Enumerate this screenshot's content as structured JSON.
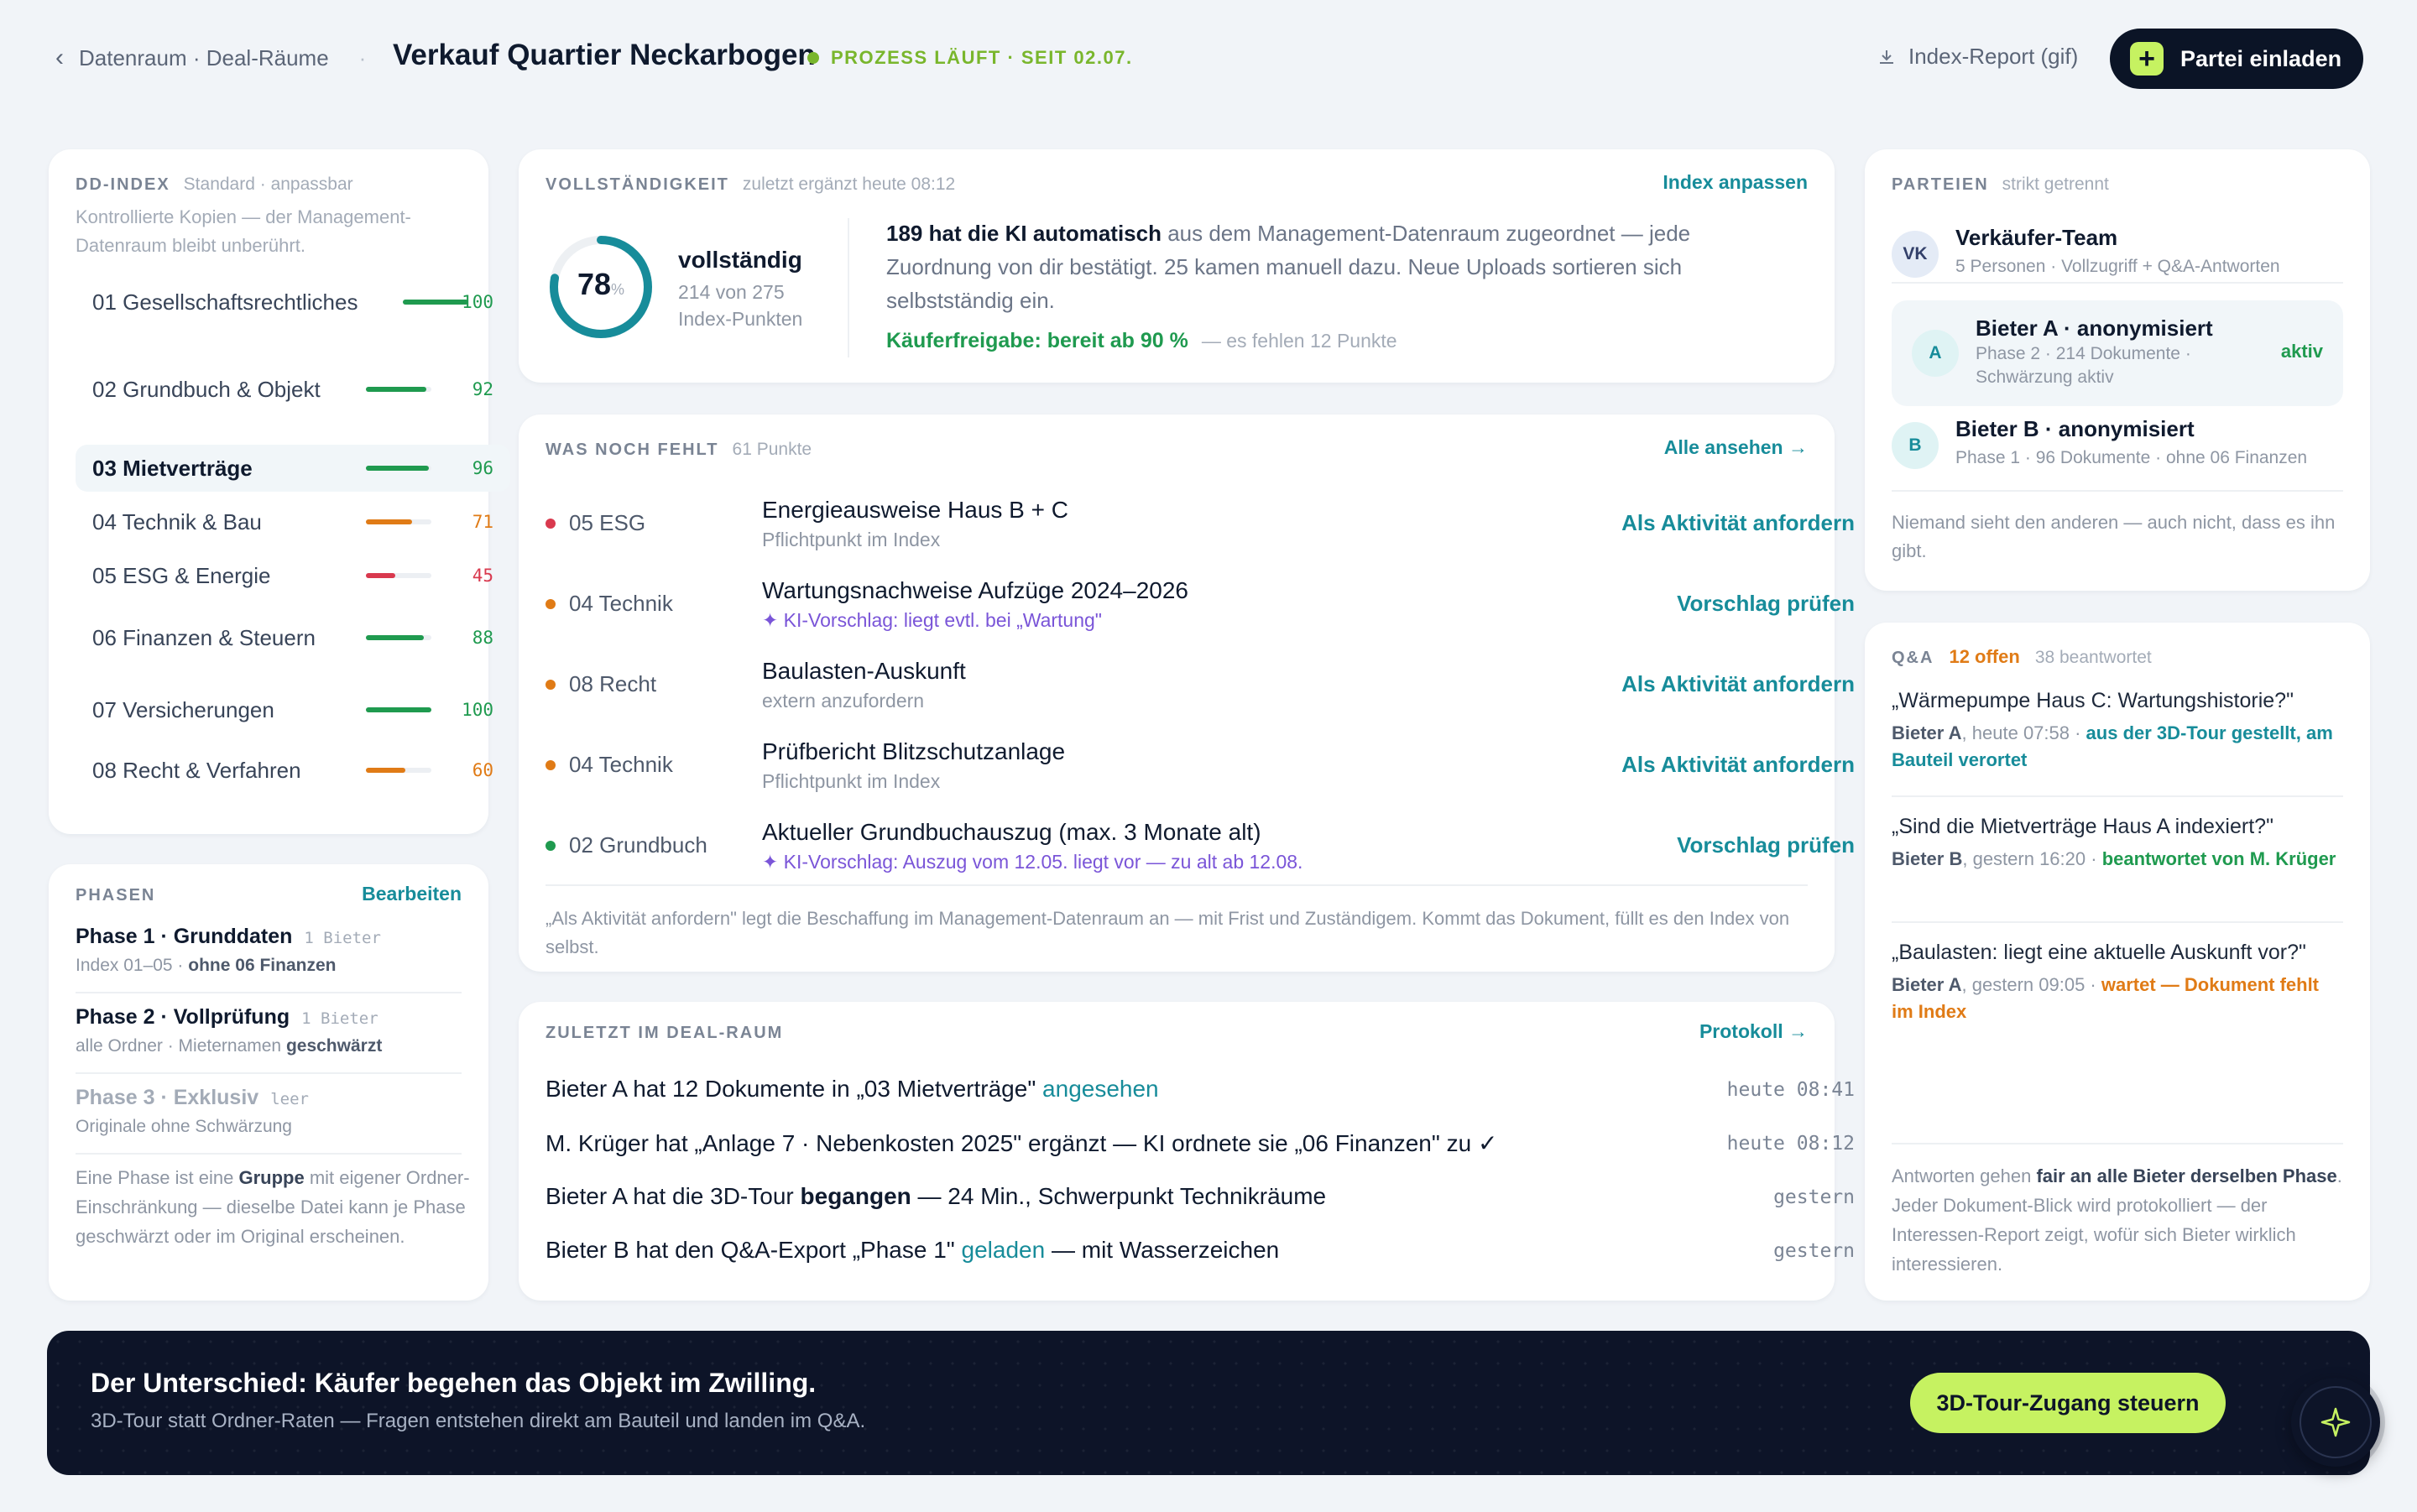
{
  "header": {
    "breadcrumb": "Datenraum · Deal-Räume",
    "title": "Verkauf Quartier Neckarbogen",
    "status": "PROZESS LÄUFT · SEIT 02.07.",
    "report_label": "Index-Report (gif)",
    "invite_label": "Partei einladen"
  },
  "dd_index": {
    "label": "DD-INDEX",
    "sublabel": "Standard · anpassbar",
    "desc": "Kontrollierte Kopien — der Management-Datenraum bleibt unberührt.",
    "items": [
      {
        "name": "01 Gesellschaftsrechtliches",
        "value": "100",
        "pct": 100,
        "color": "#1f9a4f"
      },
      {
        "name": "02 Grundbuch & Objekt",
        "value": "92",
        "pct": 92,
        "color": "#1f9a4f"
      },
      {
        "name": "03 Mietverträge",
        "value": "96",
        "pct": 96,
        "color": "#1f9a4f"
      },
      {
        "name": "04 Technik & Bau",
        "value": "71",
        "pct": 71,
        "color": "#e07b16"
      },
      {
        "name": "05 ESG & Energie",
        "value": "45",
        "pct": 45,
        "color": "#d9394e"
      },
      {
        "name": "06 Finanzen & Steuern",
        "value": "88",
        "pct": 88,
        "color": "#1f9a4f"
      },
      {
        "name": "07 Versicherungen",
        "value": "100",
        "pct": 100,
        "color": "#1f9a4f"
      },
      {
        "name": "08 Recht & Verfahren",
        "value": "60",
        "pct": 60,
        "color": "#e07b16"
      }
    ]
  },
  "phases": {
    "label": "PHASEN",
    "edit": "Bearbeiten",
    "items": [
      {
        "name": "Phase 1 · Grunddaten",
        "count": "1 Bieter",
        "desc": "Index 01–05 · ",
        "desc_b": "ohne 06 Finanzen"
      },
      {
        "name": "Phase 2 · Vollprüfung",
        "count": "1 Bieter",
        "desc": "alle Ordner · Mieternamen ",
        "desc_b": "geschwärzt"
      },
      {
        "name": "Phase 3 · Exklusiv",
        "count": "leer",
        "desc": "Originale ohne Schwärzung",
        "desc_b": ""
      }
    ],
    "note_a": "Eine Phase ist eine ",
    "note_b": "Gruppe",
    "note_c": " mit eigener Ordner-Einschränkung — dieselbe Datei kann je Phase geschwärzt oder im Original erscheinen."
  },
  "completeness": {
    "label": "VOLLSTÄNDIGKEIT",
    "sublabel": "zuletzt ergänzt heute 08:12",
    "action": "Index anpassen",
    "percent": "78",
    "percent_unit": "%",
    "fraction": 0.78,
    "state": "vollständig",
    "detail": "214 von 275 Index-Punkten",
    "ai_bold": "189 hat die KI automatisch",
    "ai_text": " aus dem Management-Datenraum zugeordnet — jede Zuordnung von dir bestätigt. 25 kamen manuell dazu. Neue Uploads sortieren sich selbstständig ein.",
    "release": "Käuferfreigabe: bereit ab 90 %",
    "missing_points": "— es fehlen 12 Punkte"
  },
  "missing": {
    "label": "WAS NOCH FEHLT",
    "sublabel": "61 Punkte",
    "action": "Alle ansehen →",
    "items": [
      {
        "color": "#d9394e",
        "cat": "05 ESG",
        "title": "Energieausweise Haus B + C",
        "desc": "Pflichtpunkt im Index",
        "ai": false,
        "act": "Als Aktivität anfordern"
      },
      {
        "color": "#e07b16",
        "cat": "04 Technik",
        "title": "Wartungsnachweise Aufzüge 2024–2026",
        "desc": "✦ KI-Vorschlag: liegt evtl. bei „Wartung\"",
        "ai": true,
        "act": "Vorschlag prüfen"
      },
      {
        "color": "#e07b16",
        "cat": "08 Recht",
        "title": "Baulasten-Auskunft",
        "desc": "extern anzufordern",
        "ai": false,
        "act": "Als Aktivität anfordern"
      },
      {
        "color": "#e07b16",
        "cat": "04 Technik",
        "title": "Prüfbericht Blitzschutzanlage",
        "desc": "Pflichtpunkt im Index",
        "ai": false,
        "act": "Als Aktivität anfordern"
      },
      {
        "color": "#1f9a4f",
        "cat": "02 Grundbuch",
        "title": "Aktueller Grundbuchauszug (max. 3 Monate alt)",
        "desc": "✦ KI-Vorschlag: Auszug vom 12.05. liegt vor — zu alt ab 12.08.",
        "ai": true,
        "act": "Vorschlag prüfen"
      }
    ],
    "note": "„Als Aktivität anfordern\" legt die Beschaffung im Management-Datenraum an — mit Frist und Zuständigem. Kommt das Dokument, füllt es den Index von selbst."
  },
  "recent": {
    "label": "ZULETZT IM DEAL-RAUM",
    "action": "Protokoll →",
    "items": [
      {
        "a": "Bieter A hat 12 Dokumente in „03 Mietverträge\" ",
        "b": "angesehen",
        "c": "",
        "time": "heute 08:41",
        "style": "teal"
      },
      {
        "a": "M. Krüger hat „Anlage 7 · Nebenkosten 2025\" ergänzt — KI ordnete sie „06 Finanzen\" zu ✓",
        "b": "",
        "c": "",
        "time": "heute 08:12",
        "style": ""
      },
      {
        "a": "Bieter A hat die 3D-Tour ",
        "b": "begangen",
        "c": " — 24 Min., Schwerpunkt Technikräume",
        "time": "gestern",
        "style": "bold"
      },
      {
        "a": "Bieter B hat den Q&A-Export „Phase 1\" ",
        "b": "geladen",
        "c": " — mit Wasserzeichen",
        "time": "gestern",
        "style": "teal"
      }
    ]
  },
  "parties": {
    "label": "PARTEIEN",
    "sublabel": "strikt getrennt",
    "items": [
      {
        "avatar": "VK",
        "name": "Verkäufer-Team",
        "desc": "5 Personen · Vollzugriff + Q&A-Antworten",
        "badge": ""
      },
      {
        "avatar": "A",
        "name": "Bieter A · anonymisiert",
        "desc": "Phase 2 · 214 Dokumente · Schwärzung aktiv",
        "badge": "aktiv"
      },
      {
        "avatar": "B",
        "name": "Bieter B · anonymisiert",
        "desc": "Phase 1 · 96 Dokumente · ohne 06 Finanzen",
        "badge": ""
      }
    ],
    "note": "Niemand sieht den anderen — auch nicht, dass es ihn gibt."
  },
  "qa": {
    "label": "Q&A",
    "open": "12 offen",
    "answered": "38 beantwortet",
    "items": [
      {
        "q": "„Wärmepumpe Haus C: Wartungshistorie?\"",
        "who": "Bieter A",
        "when": ", heute 07:58 · ",
        "status": "aus der 3D-Tour gestellt, am Bauteil verortet",
        "color": "#178c9a"
      },
      {
        "q": "„Sind die Mietverträge Haus A indexiert?\"",
        "who": "Bieter B",
        "when": ", gestern 16:20 · ",
        "status": "beantwortet von M. Krüger",
        "color": "#1f9a4f"
      },
      {
        "q": "„Baulasten: liegt eine aktuelle Auskunft vor?\"",
        "who": "Bieter A",
        "when": ", gestern 09:05 · ",
        "status": "wartet — Dokument fehlt im Index",
        "color": "#e07b16"
      }
    ],
    "note_a": "Antworten gehen ",
    "note_b": "fair an alle Bieter derselben Phase",
    "note_c": ". Jeder Dokument-Blick wird protokolliert — der Interessen-Report zeigt, wofür sich Bieter wirklich interessieren."
  },
  "banner": {
    "title": "Der Unterschied: Käufer begehen das Objekt im Zwilling.",
    "subtitle": "3D-Tour statt Ordner-Raten — Fragen entstehen direkt am Bauteil und landen im Q&A.",
    "button": "3D-Tour-Zugang steuern"
  },
  "colors": {
    "accent": "#178c9a",
    "lime": "#c6f261",
    "dark": "#0b1426",
    "green": "#1f9a4f",
    "orange": "#e07b16",
    "red": "#d9394e",
    "ai": "#7a55d8"
  },
  "icons": {
    "back": "chevron-left-icon",
    "download": "download-icon",
    "plus": "plus-icon",
    "spark": "sparkle-icon"
  }
}
